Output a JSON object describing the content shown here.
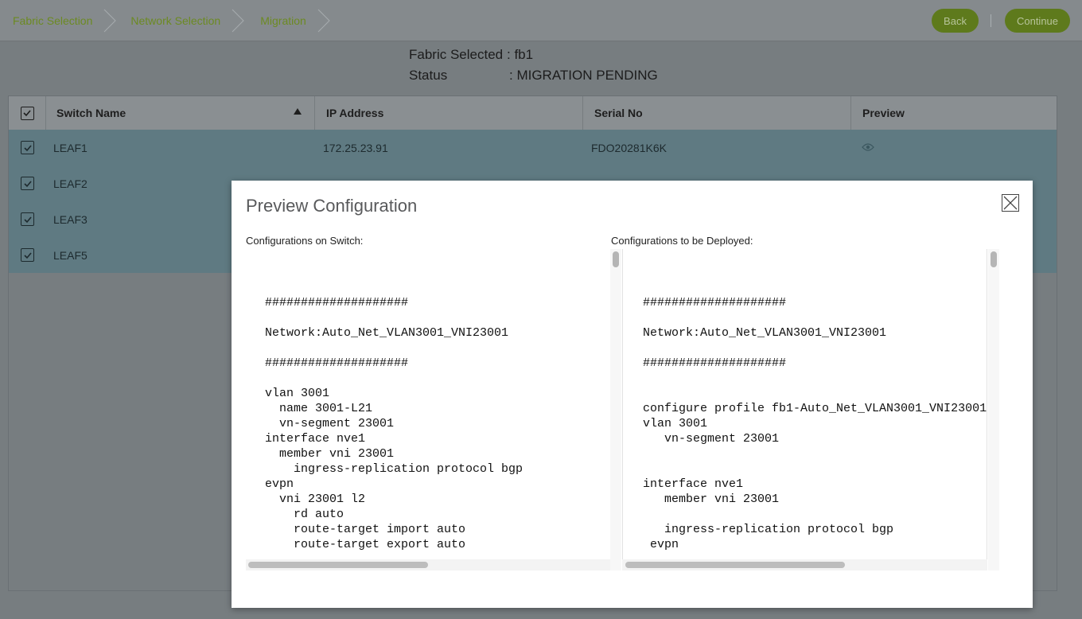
{
  "breadcrumb": {
    "items": [
      {
        "label": "Fabric Selection"
      },
      {
        "label": "Network Selection"
      },
      {
        "label": "Migration"
      }
    ]
  },
  "actions": {
    "back_label": "Back",
    "continue_label": "Continue"
  },
  "fabric": {
    "selected_key": "Fabric Selected",
    "selected_value": ": fb1",
    "status_key": "Status",
    "status_value": ": MIGRATION PENDING"
  },
  "table": {
    "columns": [
      "Switch Name",
      "IP Address",
      "Serial No",
      "Preview"
    ],
    "sort_column": "Switch Name",
    "sort_direction": "ascending",
    "rows": [
      {
        "name": "LEAF1",
        "ip": "172.25.23.91",
        "serial": "FDO20281K6K",
        "checked": true
      },
      {
        "name": "LEAF2",
        "ip": "",
        "serial": "",
        "checked": true
      },
      {
        "name": "LEAF3",
        "ip": "",
        "serial": "",
        "checked": true
      },
      {
        "name": "LEAF5",
        "ip": "",
        "serial": "",
        "checked": true
      }
    ]
  },
  "modal": {
    "title": "Preview Configuration",
    "left_label": "Configurations on Switch:",
    "right_label": "Configurations to be Deployed:",
    "left_code": "####################\n\nNetwork:Auto_Net_VLAN3001_VNI23001\n\n####################\n\nvlan 3001\n  name 3001-L21\n  vn-segment 23001\ninterface nve1\n  member vni 23001\n    ingress-replication protocol bgp\nevpn\n  vni 23001 l2\n    rd auto\n    route-target import auto\n    route-target export auto",
    "right_code": "####################\n\nNetwork:Auto_Net_VLAN3001_VNI23001\n\n####################\n\n\nconfigure profile fb1-Auto_Net_VLAN3001_VNI23001\nvlan 3001\n   vn-segment 23001\n\n\ninterface nve1\n   member vni 23001\n\n   ingress-replication protocol bgp\n evpn"
  },
  "colors": {
    "accent_green": "#5e7a1c",
    "breadcrumb_text": "#6c8a22",
    "selected_row": "#5f7a82"
  }
}
